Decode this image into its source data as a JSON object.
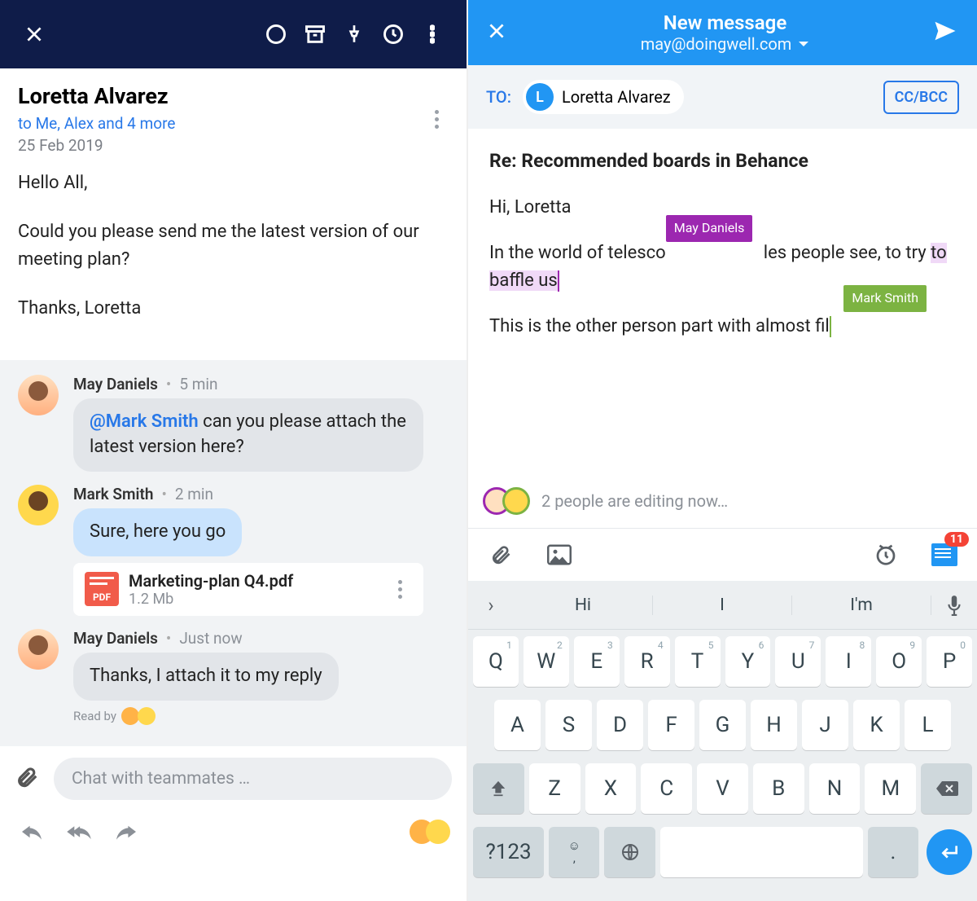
{
  "left": {
    "sender": "Loretta Alvarez",
    "recipients": "to Me, Alex and 4 more",
    "date": "25 Feb 2019",
    "body": {
      "greeting": "Hello All,",
      "para": "Could you please send me the latest version of our meeting plan?",
      "sign": "Thanks, Loretta"
    },
    "thread": [
      {
        "author": "May Daniels",
        "time": "5 min",
        "mention": "@Mark Smith",
        "text": " can you please attach the latest version here?",
        "style": "grey"
      },
      {
        "author": "Mark Smith",
        "time": "2 min",
        "text": "Sure, here you go",
        "style": "blue",
        "attachment": {
          "name": "Marketing-plan Q4.pdf",
          "size": "1.2 Mb",
          "type": "PDF"
        }
      },
      {
        "author": "May Daniels",
        "time": "Just now",
        "text": "Thanks, I attach it to my reply",
        "style": "grey"
      }
    ],
    "read_by_label": "Read by",
    "chat_placeholder": "Chat with teammates …"
  },
  "right": {
    "title": "New message",
    "from": "may@doingwell.com",
    "to_label": "TO:",
    "to_name": "Loretta Alvarez",
    "to_initial": "L",
    "ccbcc": "CC/BCC",
    "subject": "Re: Recommended boards in Behance",
    "line1": "Hi, Loretta",
    "line2_a": "In the world of telesco",
    "line2_b": "les people see, to try ",
    "line2_hl": "to baffle us",
    "line3": "This is the other person part with almost fil",
    "collab_tags": {
      "purple": "May Daniels",
      "green": "Mark Smith"
    },
    "editing_status": "2 people are editing now…",
    "badge_count": "11",
    "suggestions": [
      "Hi",
      "I",
      "I'm"
    ],
    "keyboard": {
      "row1": [
        [
          "Q",
          "1"
        ],
        [
          "W",
          "2"
        ],
        [
          "E",
          "3"
        ],
        [
          "R",
          "4"
        ],
        [
          "T",
          "5"
        ],
        [
          "Y",
          "6"
        ],
        [
          "U",
          "7"
        ],
        [
          "I",
          "8"
        ],
        [
          "O",
          "9"
        ],
        [
          "P",
          "0"
        ]
      ],
      "row2": [
        "A",
        "S",
        "D",
        "F",
        "G",
        "H",
        "J",
        "K",
        "L"
      ],
      "row3": [
        "Z",
        "X",
        "C",
        "V",
        "B",
        "N",
        "M"
      ],
      "sym": "?123"
    }
  }
}
